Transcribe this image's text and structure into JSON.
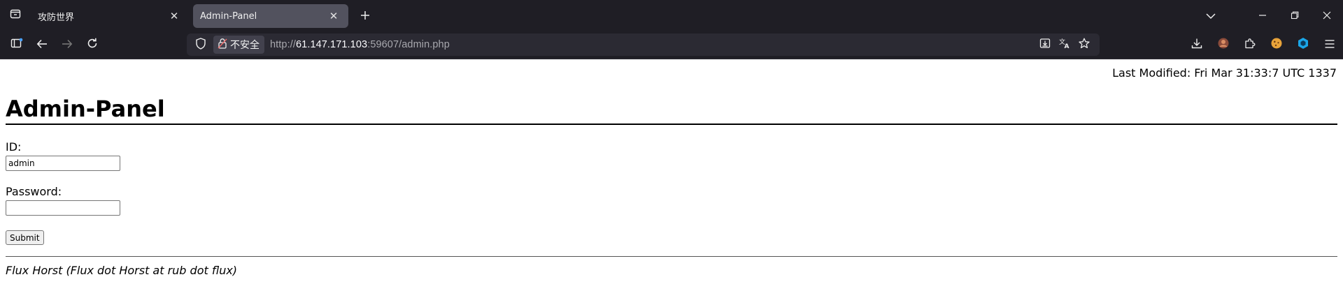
{
  "browser": {
    "tabs": [
      {
        "label": "攻防世界",
        "active": false
      },
      {
        "label": "Admin-Panel",
        "active": true
      }
    ],
    "url": {
      "security_label": "不安全",
      "prefix": "http://",
      "host": "61.147.171.103",
      "rest": ":59607/admin.php"
    },
    "accent_color": "#52525e"
  },
  "page": {
    "last_modified": "Last Modified: Fri Mar 31:33:7 UTC 1337",
    "title": "Admin-Panel",
    "form": {
      "id_label": "ID:",
      "id_value": "admin",
      "password_label": "Password:",
      "password_value": "",
      "submit_label": "Submit"
    },
    "footer": "Flux Horst (Flux dot Horst at rub dot flux)"
  }
}
